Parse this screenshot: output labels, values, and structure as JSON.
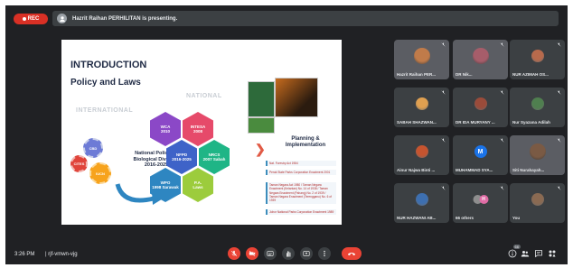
{
  "recording": {
    "label": "REC"
  },
  "presenter_bar": {
    "text": "Hazrit Raihan PERHILITAN is presenting."
  },
  "slide": {
    "title": "INTRODUCTION",
    "subtitle": "Policy and Laws",
    "label_international": "INTERNATIONAL",
    "label_national": "NATIONAL",
    "gears": [
      {
        "label": "CBD",
        "color": "#6d7bd6"
      },
      {
        "label": "CITES",
        "color": "#e0443a"
      },
      {
        "label": "IUCN",
        "color": "#f7a31c"
      }
    ],
    "policy_text": "National Policy on Biological Diversity 2016-2025",
    "hexes": [
      {
        "line1": "WCA",
        "line2": "2010"
      },
      {
        "line1": "INTESA",
        "line2": "2008"
      },
      {
        "line1": "NFPD",
        "line2": "2016-2025"
      },
      {
        "line1": "NRCS",
        "line2": "2007 Sabah"
      },
      {
        "line1": "WPO",
        "line2": "1998 Sarawak"
      },
      {
        "line1": "P.A.",
        "line2": "Laws"
      }
    ],
    "planning_text": "Planning & Implementation",
    "laws": [
      "Nat. Forestry Act 1984",
      "Perak State Parks Corporation Enactment 2001",
      "Taman Negara Act 1980 / Taman Negara Enactment (Kelantan) No. 14 of 1938 / Taman Negara Enactment (Pahang) No. 2 of 1939 / Taman Negara Enactment (Terengganu) No. 6 of 1939",
      "Johor National Parks Corporation Enactment 1989"
    ]
  },
  "participants": [
    {
      "name": "Hazrit Raihan PER...",
      "type": "video",
      "color": "#c07b4a"
    },
    {
      "name": "DR Nik...",
      "type": "video",
      "color": "#a65d6a"
    },
    {
      "name": "NUR AZIMAH OS...",
      "type": "avatar",
      "color": "#b86a4c"
    },
    {
      "name": "SABAH SHAZWAN...",
      "type": "avatar",
      "color": "#e0a050"
    },
    {
      "name": "DR IDA MURYANY ...",
      "type": "avatar",
      "color": "#9a4b3a"
    },
    {
      "name": "Nur Syazana Adilah",
      "type": "avatar",
      "color": "#4f7f4f"
    },
    {
      "name": "Ainur Najwa Binti ...",
      "type": "avatar",
      "color": "#c6542f"
    },
    {
      "name": "MUHAMMAD SYA...",
      "type": "letter",
      "letter": "M",
      "color": "#1a73e8"
    },
    {
      "name": "Siti Nurahayah...",
      "type": "video",
      "color": "#7a5a44"
    },
    {
      "name": "NUR HAZWANI AB...",
      "type": "avatar",
      "color": "#3d6fb0"
    },
    {
      "name": "66 others",
      "type": "others",
      "letter": "H",
      "color": "#e06ca5"
    },
    {
      "name": "You",
      "type": "avatar",
      "color": "#8a6a52"
    }
  ],
  "bottom_bar": {
    "time": "3:26 PM",
    "separator": "|",
    "meeting_code": "rjf-vmwn-vjg",
    "participant_count": "66"
  }
}
